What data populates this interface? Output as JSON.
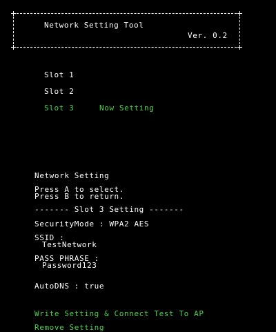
{
  "header": {
    "title": "Network Setting Tool",
    "version": "Ver. 0.2"
  },
  "slots": {
    "items": [
      {
        "label": "Slot 1",
        "status": ""
      },
      {
        "label": "Slot 2",
        "status": ""
      },
      {
        "label": "Slot 3",
        "status": "Now Setting"
      }
    ]
  },
  "panel": {
    "heading": "Network Setting",
    "help_select": "Press A to select.",
    "help_return": "Press B to return.",
    "section_title": "------- Slot 3 Setting -------",
    "security_mode": "SecurityMode : WPA2 AES",
    "ssid_label": "SSID :",
    "ssid_value": "TestNetwork",
    "pass_label": "PASS PHRASE :",
    "pass_value": "Password123",
    "auto_dns": "AutoDNS : true",
    "write_action": "Write Setting & Connect Test To AP",
    "remove_action": "Remove Setting"
  },
  "colors": {
    "background": "#000000",
    "text": "#ffffff",
    "highlight": "#4ed04e"
  }
}
